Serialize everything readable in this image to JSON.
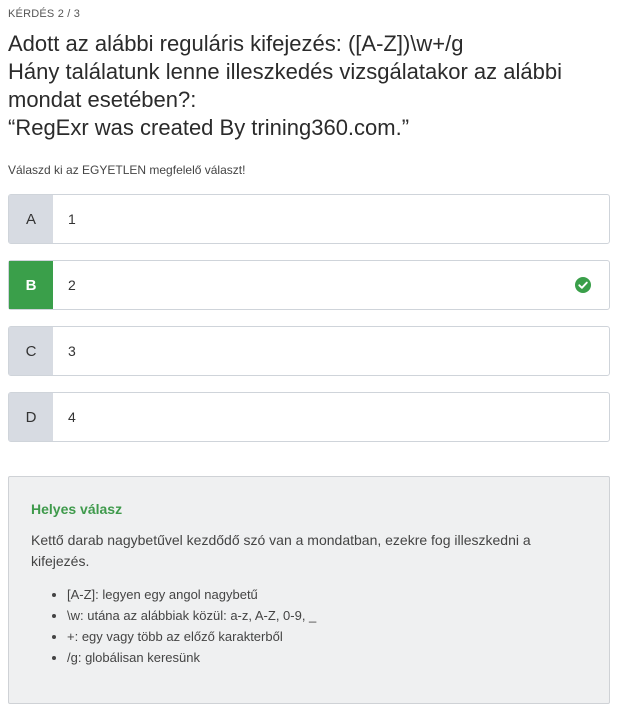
{
  "header": {
    "counter": "KÉRDÉS 2 / 3"
  },
  "question": {
    "lines": [
      "Adott az alábbi reguláris kifejezés: ([A-Z])\\w+/g",
      "Hány találatunk lenne illeszkedés vizsgálatakor az alábbi",
      "mondat esetében?:",
      "“RegExr was created By trining360.com.”"
    ]
  },
  "instruction": "Válaszd ki az EGYETLEN megfelelő választ!",
  "answers": [
    {
      "letter": "A",
      "value": "1",
      "correct": false
    },
    {
      "letter": "B",
      "value": "2",
      "correct": true
    },
    {
      "letter": "C",
      "value": "3",
      "correct": false
    },
    {
      "letter": "D",
      "value": "4",
      "correct": false
    }
  ],
  "explanation": {
    "title": "Helyes válasz",
    "text": "Kettő darab nagybetűvel kezdődő szó van a mondatban, ezekre fog illeszkedni a kifejezés.",
    "bullets": [
      "[A-Z]: legyen egy angol nagybetű",
      "\\w: utána az alábbiak közül: a-z, A-Z, 0-9, _",
      "+: egy vagy több az előző karakterből",
      "/g: globálisan keresünk"
    ]
  },
  "colors": {
    "correct": "#3a9f4a",
    "letter_bg": "#d7dbe2",
    "explain_title": "#3f9a4c",
    "explain_bg": "#eff0f1"
  },
  "icons": {
    "correct_marker": "check-circle-icon"
  }
}
